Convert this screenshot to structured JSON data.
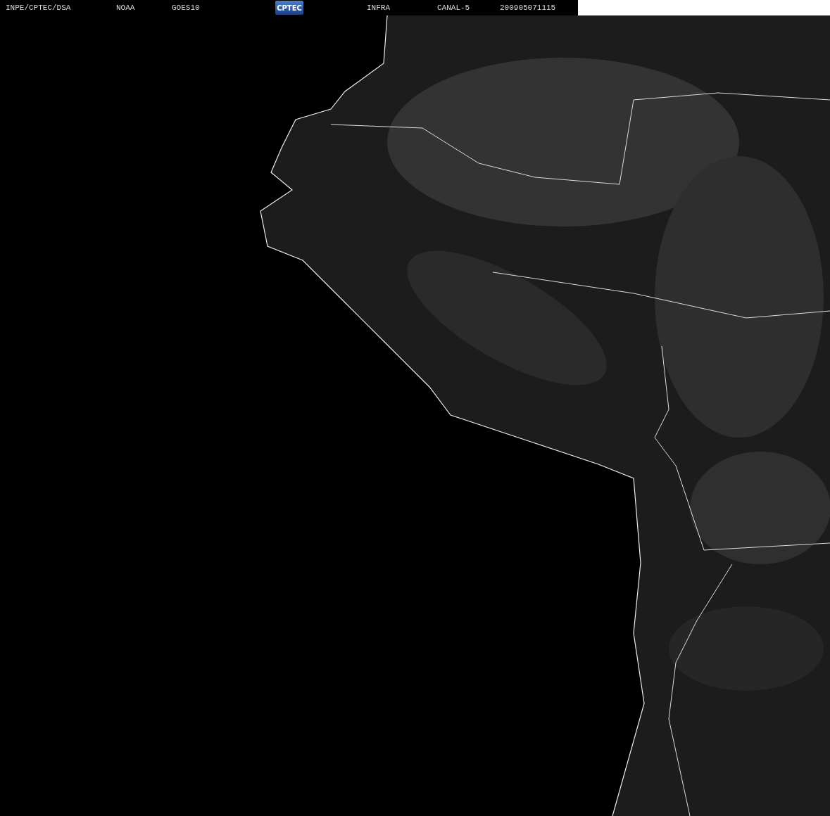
{
  "header": {
    "labels": [
      "INPE/CPTEC/DSA",
      "NOAA",
      "GOES10"
    ],
    "logo": "CPTEC",
    "labels_after": [
      "INFRA",
      "CANAL-5",
      "200905071115"
    ]
  }
}
